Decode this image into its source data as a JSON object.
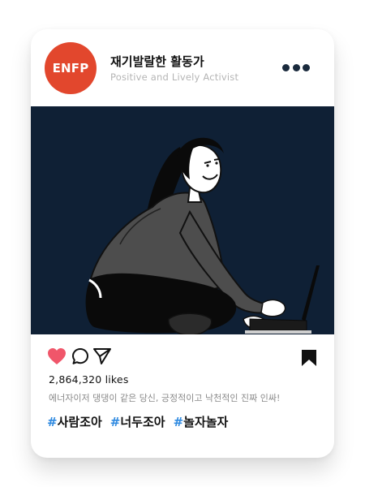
{
  "profile": {
    "avatar_text": "ENFP",
    "name": "재기발랄한 활동가",
    "subtitle": "Positive and Lively Activist",
    "avatar_color": "#e2472d"
  },
  "post": {
    "image_alt": "Woman with long dark hair sitting on the floor typing on a laptop",
    "background_color": "#0f2035",
    "likes": "2,864,320 likes",
    "caption": "에너자이저 댕댕이 같은 당신, 긍정적이고 낙천적인 진짜 인싸!",
    "hashtags": [
      {
        "hash": "#",
        "text": "사람조아"
      },
      {
        "hash": "#",
        "text": "너두조아"
      },
      {
        "hash": "#",
        "text": "놀자놀자"
      }
    ]
  },
  "icons": {
    "more": "more-options-icon",
    "like": "heart-icon",
    "comment": "comment-icon",
    "share": "send-icon",
    "save": "bookmark-icon"
  },
  "colors": {
    "heart": "#f0566a",
    "hashtag": "#2f8ae0",
    "dots": "#1a2a3d"
  }
}
